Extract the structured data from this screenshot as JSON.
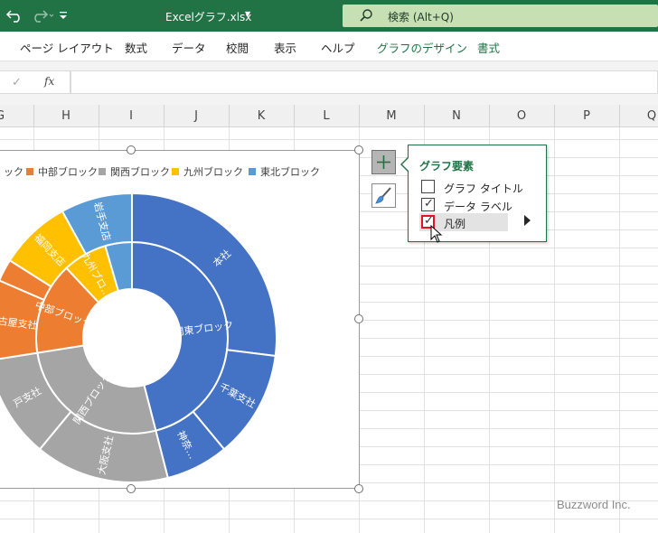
{
  "titlebar": {
    "doc_title": "Excelグラフ.xlsx",
    "search_text": "検索 (Alt+Q)"
  },
  "ribbon_tabs": [
    {
      "label": "ページ レイアウト"
    },
    {
      "label": "数式"
    },
    {
      "label": "データ"
    },
    {
      "label": "校閲"
    },
    {
      "label": "表示"
    },
    {
      "label": "ヘルプ"
    },
    {
      "label": "グラフのデザイン"
    },
    {
      "label": "書式"
    }
  ],
  "formula_bar": {
    "fx_label": "fx",
    "value": ""
  },
  "columns": [
    "G",
    "H",
    "I",
    "J",
    "K",
    "L",
    "M",
    "N",
    "O",
    "P",
    "Q"
  ],
  "chart_data": {
    "type": "pie",
    "title": "",
    "legend": {
      "position": "top",
      "entries": [
        {
          "name": "ック",
          "color": "#4472C4"
        },
        {
          "name": "中部ブロック",
          "color": "#ED7D31"
        },
        {
          "name": "関西ブロック",
          "color": "#A5A5A5"
        },
        {
          "name": "九州ブロック",
          "color": "#FFC000"
        },
        {
          "name": "東北ブロック",
          "color": "#5B9BD5"
        }
      ]
    },
    "series": [
      {
        "ring": "inner",
        "labels": [
          "関東ブロック",
          "関西ブロック",
          "中部ブロック",
          "九州ブロ…",
          ""
        ],
        "values": [
          46,
          26.5,
          15.5,
          7.5,
          4.5
        ],
        "colors": [
          "#4472C4",
          "#A5A5A5",
          "#ED7D31",
          "#FFC000",
          "#5B9BD5"
        ]
      },
      {
        "ring": "outer",
        "labels": [
          "本社",
          "千葉支社",
          "神奈…",
          "大阪支社",
          "戸支社",
          "名古屋支社",
          "",
          "福岡支店",
          "岩手支店"
        ],
        "values": [
          27,
          12,
          7,
          15,
          11.5,
          9,
          2.5,
          8,
          8
        ],
        "colors": [
          "#4472C4",
          "#4472C4",
          "#4472C4",
          "#A5A5A5",
          "#A5A5A5",
          "#ED7D31",
          "#ED7D31",
          "#FFC000",
          "#5B9BD5"
        ]
      }
    ]
  },
  "chart_elements_popup": {
    "title": "グラフ要素",
    "items": [
      {
        "label": "グラフ タイトル",
        "checked": false
      },
      {
        "label": "データ ラベル",
        "checked": true
      },
      {
        "label": "凡例",
        "checked": true
      }
    ]
  },
  "watermark": "Buzzword Inc."
}
